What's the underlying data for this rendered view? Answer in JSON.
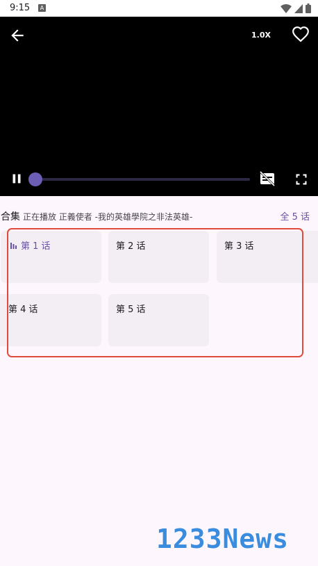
{
  "status_bar": {
    "time": "9:15",
    "notification_glyph": "A",
    "icons": [
      "wifi-icon",
      "signal-icon",
      "battery-icon"
    ]
  },
  "player": {
    "speed_label": "1.0X",
    "progress": 0.0,
    "accent_color": "#6c5eb5",
    "icons": [
      "back-arrow-icon",
      "heart-icon",
      "pause-icon",
      "subtitles-off-icon",
      "fullscreen-icon"
    ]
  },
  "episodes": {
    "title": "合集",
    "now_playing": "正在播放 正義使者 -我的英雄學院之非法英雄-",
    "total_label": "全 5 话",
    "items": [
      {
        "label": "第 1 话",
        "active": true
      },
      {
        "label": "第 2 话",
        "active": false
      },
      {
        "label": "第 3 话",
        "active": false
      },
      {
        "label": "第 4 话",
        "active": false
      },
      {
        "label": "第 5 话",
        "active": false
      }
    ]
  },
  "watermark": {
    "text": "1233News",
    "color": "#3a8dde"
  }
}
